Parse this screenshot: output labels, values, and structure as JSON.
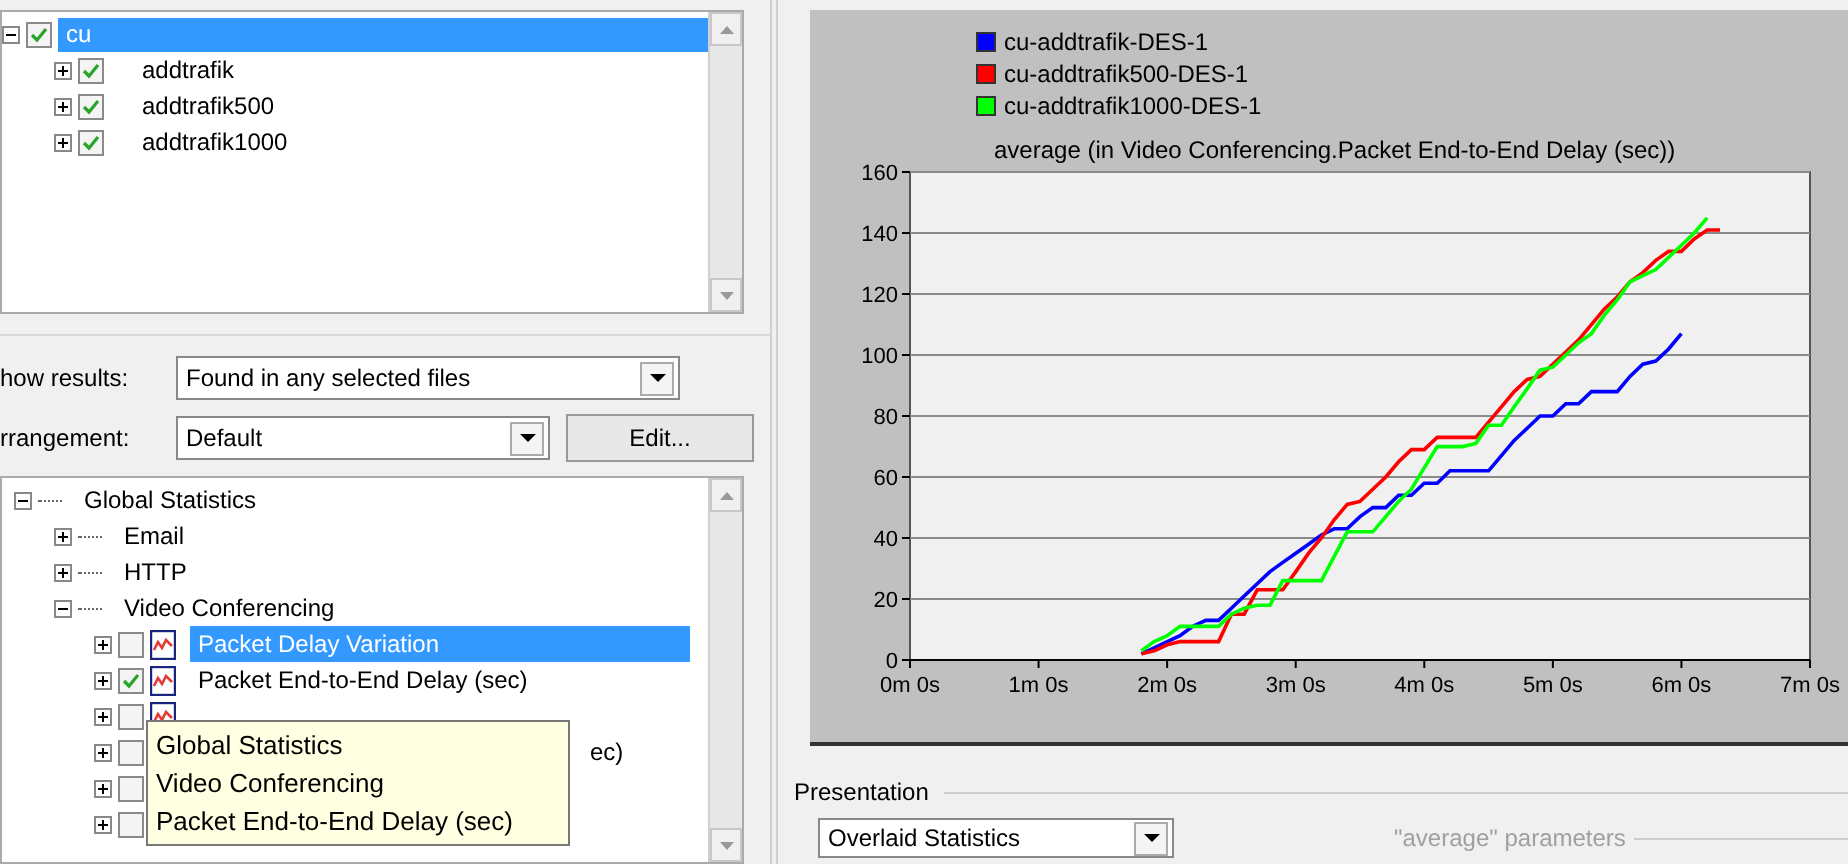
{
  "file_tree": [
    {
      "label": "cu",
      "checked": true,
      "selected": true,
      "expanded": true,
      "children": [
        {
          "label": "addtrafik",
          "checked": true,
          "selected": false,
          "expanded": false
        },
        {
          "label": "addtrafik500",
          "checked": true,
          "selected": false,
          "expanded": false
        },
        {
          "label": "addtrafik1000",
          "checked": true,
          "selected": false,
          "expanded": false
        }
      ]
    }
  ],
  "show_results": {
    "label": "how results:",
    "value": "Found in any selected files"
  },
  "arrangement": {
    "label": "rrangement:",
    "value": "Default",
    "button": "Edit..."
  },
  "stat_tree": [
    {
      "label": "Global Statistics",
      "kind": "group",
      "expanded": true,
      "children": [
        {
          "label": "Email",
          "kind": "group",
          "expanded": false
        },
        {
          "label": "HTTP",
          "kind": "group",
          "expanded": false
        },
        {
          "label": "Video Conferencing",
          "kind": "group",
          "expanded": true,
          "children": [
            {
              "label": "Packet Delay Variation",
              "kind": "stat",
              "checked": false,
              "selected": true
            },
            {
              "label": "Packet End-to-End Delay (sec)",
              "kind": "stat",
              "checked": true,
              "selected": false
            },
            {
              "kind": "stat",
              "checked": false
            },
            {
              "label": "ec)",
              "kind": "stat",
              "checked": false
            },
            {
              "kind": "stat",
              "checked": false
            },
            {
              "kind": "stat",
              "checked": false
            }
          ]
        }
      ]
    }
  ],
  "tooltip": [
    "Global Statistics",
    "Video Conferencing",
    "Packet End-to-End Delay (sec)"
  ],
  "chart": {
    "chart_data": {
      "type": "line",
      "title": "average (in Video Conferencing.Packet End-to-End Delay (sec))",
      "categories": [
        "0m 0s",
        null,
        null,
        null,
        null,
        null,
        null,
        null,
        null,
        null,
        "1m 0s",
        null,
        null,
        null,
        null,
        null,
        null,
        null,
        null,
        null,
        "2m 0s",
        null,
        null,
        null,
        null,
        null,
        null,
        null,
        null,
        null,
        "3m 0s",
        null,
        null,
        null,
        null,
        null,
        null,
        null,
        null,
        null,
        "4m 0s",
        null,
        null,
        null,
        null,
        null,
        null,
        null,
        null,
        null,
        "5m 0s",
        null,
        null,
        null,
        null,
        null,
        null,
        null,
        null,
        null,
        "6m 0s",
        null,
        null,
        null,
        null,
        null,
        null,
        null,
        null,
        null,
        "7m 0s"
      ],
      "series": [
        {
          "name": "cu-addtrafik-DES-1",
          "color": "#0000ff",
          "values": [
            null,
            null,
            null,
            null,
            null,
            null,
            null,
            null,
            null,
            null,
            null,
            null,
            null,
            null,
            null,
            null,
            null,
            null,
            2,
            4,
            6,
            8,
            11,
            13,
            13,
            17,
            21,
            25,
            29,
            32,
            35,
            38,
            41,
            43,
            43,
            47,
            50,
            50,
            54,
            54,
            58,
            58,
            62,
            62,
            62,
            62,
            67,
            72,
            76,
            80,
            80,
            84,
            84,
            88,
            88,
            88,
            93,
            97,
            98,
            102,
            107,
            null,
            null,
            null,
            null,
            null,
            null,
            null,
            null,
            null,
            null
          ]
        },
        {
          "name": "cu-addtrafik500-DES-1",
          "color": "#ff0000",
          "values": [
            null,
            null,
            null,
            null,
            null,
            null,
            null,
            null,
            null,
            null,
            null,
            null,
            null,
            null,
            null,
            null,
            null,
            null,
            2,
            3,
            5,
            6,
            6,
            6,
            6,
            15,
            15,
            23,
            23,
            23,
            29,
            35,
            40,
            46,
            51,
            52,
            56,
            60,
            65,
            69,
            69,
            73,
            73,
            73,
            73,
            78,
            83,
            88,
            92,
            93,
            97,
            101,
            105,
            110,
            115,
            119,
            124,
            127,
            131,
            134,
            134,
            138,
            141,
            141,
            null,
            null,
            null,
            null,
            null,
            null,
            null
          ]
        },
        {
          "name": "cu-addtrafik1000-DES-1",
          "color": "#00ff00",
          "values": [
            null,
            null,
            null,
            null,
            null,
            null,
            null,
            null,
            null,
            null,
            null,
            null,
            null,
            null,
            null,
            null,
            null,
            null,
            3,
            6,
            8,
            11,
            11,
            11,
            11,
            15,
            17,
            18,
            18,
            26,
            26,
            26,
            26,
            34,
            42,
            42,
            42,
            47,
            52,
            56,
            63,
            70,
            70,
            70,
            71,
            77,
            77,
            83,
            89,
            95,
            96,
            100,
            104,
            107,
            113,
            118,
            124,
            126,
            128,
            132,
            136,
            140,
            145,
            null,
            null,
            null,
            null,
            null,
            null,
            null,
            null
          ]
        }
      ],
      "grid": true,
      "ylim": [
        0,
        160
      ],
      "yticks": [
        0,
        20,
        40,
        60,
        80,
        100,
        120,
        140,
        160
      ]
    }
  },
  "presentation": {
    "title": "Presentation",
    "value": "Overlaid Statistics",
    "parameters_title": "\"average\" parameters"
  }
}
